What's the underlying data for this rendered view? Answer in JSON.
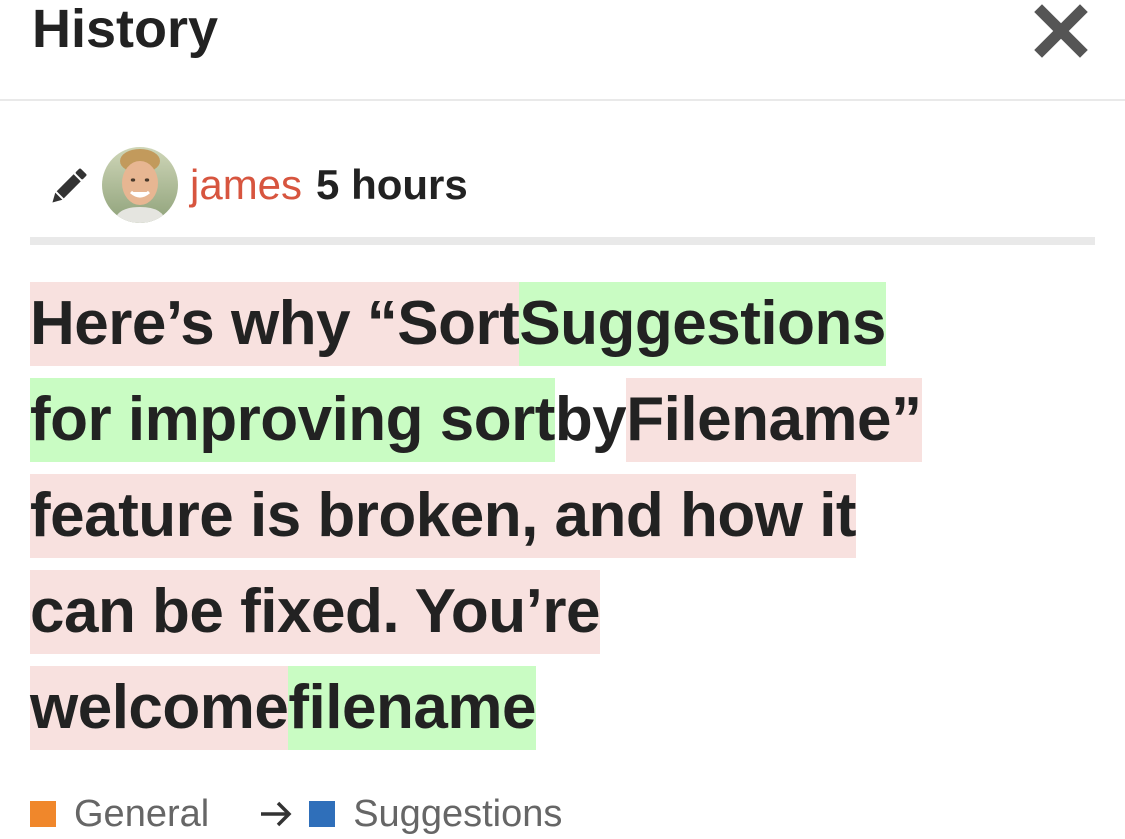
{
  "header": {
    "title": "History",
    "close_icon": "close-icon"
  },
  "revision": {
    "edit_icon": "pencil-icon",
    "avatar_icon": "user-avatar",
    "username": "james",
    "age": "5 hours"
  },
  "title_diff": {
    "lines": [
      [
        {
          "text": "Here’s why “Sort ",
          "type": "deleted"
        },
        {
          "text": "Suggestions",
          "type": "inserted"
        }
      ],
      [
        {
          "text": "for improving sort ",
          "type": "inserted"
        },
        {
          "text": "by ",
          "type": "unchanged"
        },
        {
          "text": "Filename”",
          "type": "deleted"
        }
      ],
      [
        {
          "text": "feature is broken, and how it",
          "type": "deleted"
        }
      ],
      [
        {
          "text": "can be fixed. You’re",
          "type": "deleted"
        }
      ],
      [
        {
          "text": "welcome",
          "type": "deleted"
        },
        {
          "text": "filename",
          "type": "inserted"
        }
      ]
    ]
  },
  "category_change": {
    "from": {
      "label": "General",
      "color": "#f0872b"
    },
    "arrow_icon": "arrow-right-icon",
    "to": {
      "label": "Suggestions",
      "color": "#2f6fba"
    }
  },
  "colors": {
    "deleted_bg": "#f8e1df",
    "inserted_bg": "#c9fcc3",
    "username": "#d7553f"
  }
}
